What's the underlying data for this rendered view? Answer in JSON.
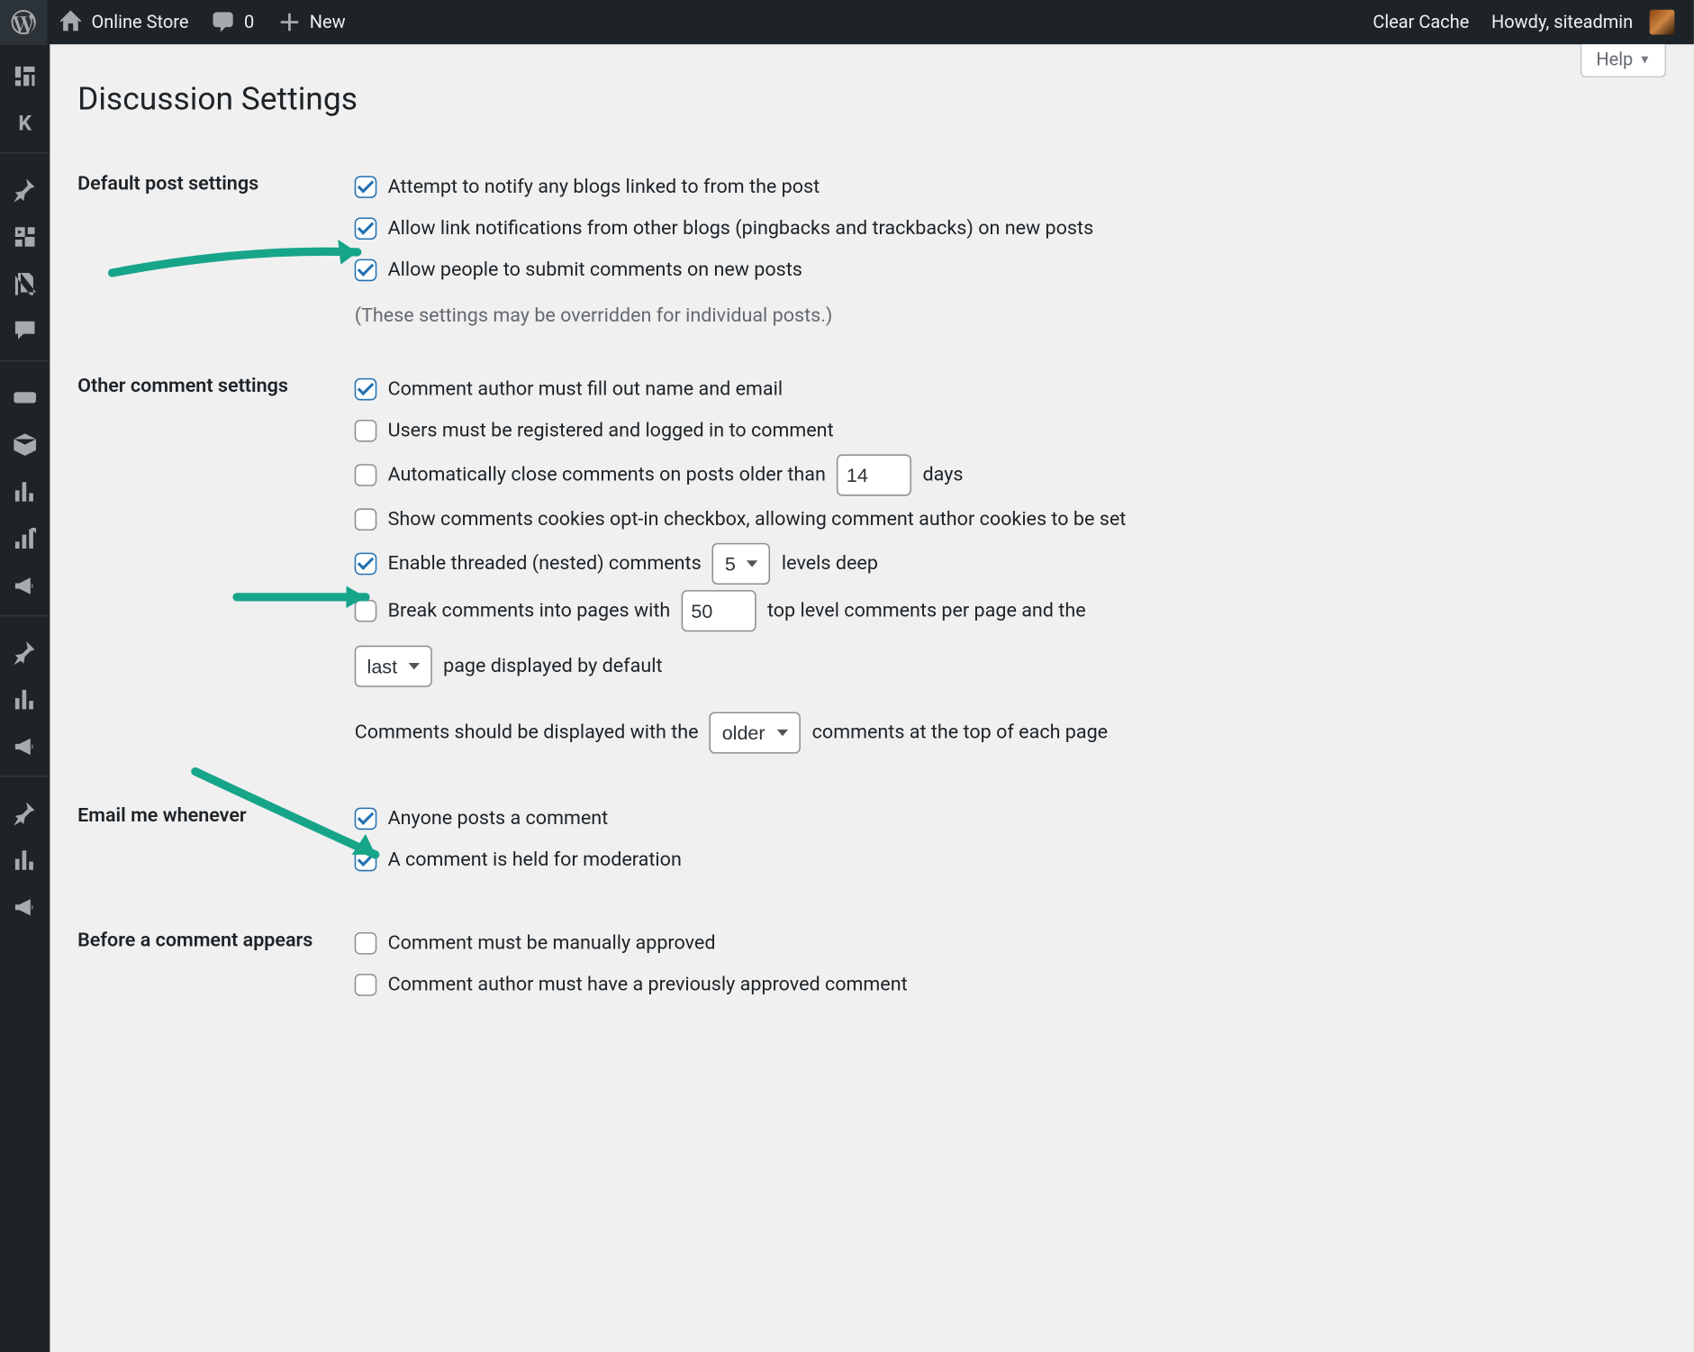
{
  "adminbar": {
    "site_name": "Online Store",
    "comments_count": "0",
    "new_label": "New",
    "clear_cache": "Clear Cache",
    "howdy": "Howdy, siteadmin"
  },
  "help_label": "Help",
  "page_title": "Discussion Settings",
  "sections": {
    "default_post": {
      "heading": "Default post settings",
      "opt_notify": "Attempt to notify any blogs linked to from the post",
      "opt_pingback": "Allow link notifications from other blogs (pingbacks and trackbacks) on new posts",
      "opt_allow_comments": "Allow people to submit comments on new posts",
      "note": "(These settings may be overridden for individual posts.)"
    },
    "other": {
      "heading": "Other comment settings",
      "opt_name_email": "Comment author must fill out name and email",
      "opt_registered": "Users must be registered and logged in to comment",
      "opt_autoclose_pre": "Automatically close comments on posts older than",
      "opt_autoclose_days": "14",
      "opt_autoclose_post": "days",
      "opt_cookies": "Show comments cookies opt-in checkbox, allowing comment author cookies to be set",
      "opt_threaded_pre": "Enable threaded (nested) comments",
      "opt_threaded_depth": "5",
      "opt_threaded_post": "levels deep",
      "opt_paginate_pre": "Break comments into pages with",
      "opt_paginate_count": "50",
      "opt_paginate_mid": "top level comments per page and the",
      "opt_paginate_page": "last",
      "opt_paginate_post": "page displayed by default",
      "opt_order_pre": "Comments should be displayed with the",
      "opt_order_value": "older",
      "opt_order_post": "comments at the top of each page"
    },
    "email": {
      "heading": "Email me whenever",
      "opt_anyone": "Anyone posts a comment",
      "opt_moderation": "A comment is held for moderation"
    },
    "before": {
      "heading": "Before a comment appears",
      "opt_manual": "Comment must be manually approved",
      "opt_prev_approved": "Comment author must have a previously approved comment"
    }
  }
}
